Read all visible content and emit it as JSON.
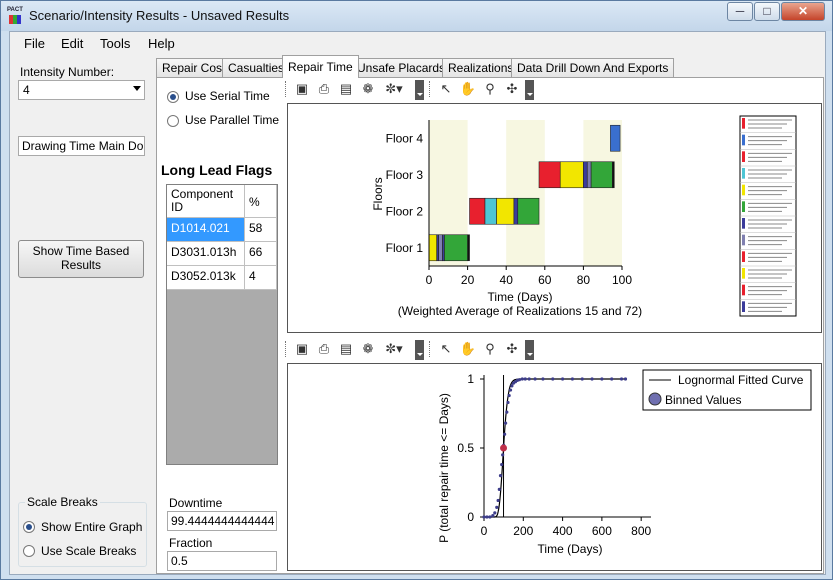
{
  "window": {
    "title": "Scenario/Intensity Results - Unsaved Results",
    "app_badge": "PACT"
  },
  "menu": [
    "File",
    "Edit",
    "Tools",
    "Help"
  ],
  "left_panel": {
    "intensity_label": "Intensity Number:",
    "intensity_value": "4",
    "status_text": "Drawing Time Main Done",
    "show_time_button": "Show Time Based Results",
    "scale_breaks": {
      "title": "Scale Breaks",
      "options": [
        "Show Entire Graph",
        "Use Scale Breaks"
      ],
      "selected": 0
    }
  },
  "tabs": [
    "Repair Cost",
    "Casualties",
    "Repair Time",
    "Unsafe Placards",
    "Realizations",
    "Data Drill Down And Exports"
  ],
  "active_tab": 2,
  "repair_time": {
    "time_mode": {
      "options": [
        "Use Serial Time",
        "Use Parallel Time"
      ],
      "selected": 0
    },
    "long_lead_title": "Long Lead Flags",
    "grid": {
      "headers": [
        "Component ID",
        "%"
      ],
      "rows": [
        [
          "D1014.021",
          "58"
        ],
        [
          "D3031.013h",
          "66"
        ],
        [
          "D3052.013k",
          "4"
        ]
      ],
      "selected_row": 0
    },
    "downtime_label": "Downtime",
    "downtime_value": "99.4444444444444",
    "fraction_label": "Fraction",
    "fraction_value": "0.5"
  },
  "colors": {
    "accent": "#3399ff",
    "band": "#f7f7e1",
    "fit_curve": "#000000",
    "binned": "#3d3d8a",
    "median": "#c0304a"
  },
  "chart_data": [
    {
      "type": "bar",
      "orientation": "horizontal-gantt",
      "title": "",
      "xlabel": "Time (Days)",
      "subtitle": "(Weighted Average of Realizations 15 and 72)",
      "ylabel": "Floors",
      "categories": [
        "Floor 1",
        "Floor 2",
        "Floor 3",
        "Floor 4"
      ],
      "xlim": [
        0,
        100
      ],
      "xticks": [
        0,
        20,
        40,
        60,
        80,
        100
      ],
      "bands": [
        [
          0,
          20
        ],
        [
          40,
          60
        ],
        [
          80,
          100
        ]
      ],
      "segments": [
        {
          "floor": "Floor 1",
          "start": 0,
          "end": 4,
          "color": "#f2e600"
        },
        {
          "floor": "Floor 1",
          "start": 4,
          "end": 5,
          "color": "#3b3b9a"
        },
        {
          "floor": "Floor 1",
          "start": 5,
          "end": 7,
          "color": "#8080b0"
        },
        {
          "floor": "Floor 1",
          "start": 7,
          "end": 8,
          "color": "#3b3b9a"
        },
        {
          "floor": "Floor 1",
          "start": 8,
          "end": 20,
          "color": "#33a639"
        },
        {
          "floor": "Floor 1",
          "start": 20,
          "end": 21,
          "color": "#111111"
        },
        {
          "floor": "Floor 2",
          "start": 21,
          "end": 29,
          "color": "#e8202e"
        },
        {
          "floor": "Floor 2",
          "start": 29,
          "end": 35,
          "color": "#4ec5d4"
        },
        {
          "floor": "Floor 2",
          "start": 35,
          "end": 44,
          "color": "#f2e600"
        },
        {
          "floor": "Floor 2",
          "start": 44,
          "end": 46,
          "color": "#3b3b9a"
        },
        {
          "floor": "Floor 2",
          "start": 46,
          "end": 57,
          "color": "#33a639"
        },
        {
          "floor": "Floor 3",
          "start": 57,
          "end": 68,
          "color": "#e8202e"
        },
        {
          "floor": "Floor 3",
          "start": 68,
          "end": 80,
          "color": "#f2e600"
        },
        {
          "floor": "Floor 3",
          "start": 80,
          "end": 82,
          "color": "#3b3b9a"
        },
        {
          "floor": "Floor 3",
          "start": 82,
          "end": 84,
          "color": "#7a7ab0"
        },
        {
          "floor": "Floor 3",
          "start": 84,
          "end": 95,
          "color": "#33a639"
        },
        {
          "floor": "Floor 3",
          "start": 95,
          "end": 96,
          "color": "#111111"
        },
        {
          "floor": "Floor 4",
          "start": 94,
          "end": 99,
          "color": "#3a6fcf"
        }
      ],
      "legend_entries": 12,
      "legend_colors": [
        "#e8202e",
        "#3a6fcf",
        "#e8202e",
        "#4ec5d4",
        "#f2e600",
        "#33a639",
        "#3b3b9a",
        "#8080b0",
        "#e8202e",
        "#f2e600",
        "#e8202e",
        "#3b3b9a"
      ]
    },
    {
      "type": "line",
      "title": "",
      "xlabel": "Time (Days)",
      "ylabel": "P (total repair time <= Days)",
      "xlim": [
        0,
        850
      ],
      "ylim": [
        0,
        1
      ],
      "xticks": [
        0,
        200,
        400,
        600,
        800
      ],
      "yticks": [
        0,
        0.5,
        1
      ],
      "series": [
        {
          "name": "Lognormal Fitted Curve",
          "style": "line",
          "median": 99.4,
          "beta": 0.18
        },
        {
          "name": "Binned Values",
          "style": "markers",
          "x": [
            0,
            15,
            30,
            45,
            55,
            65,
            72,
            78,
            84,
            90,
            95,
            100,
            105,
            110,
            116,
            122,
            128,
            135,
            142,
            150,
            160,
            170,
            180,
            195,
            210,
            230,
            260,
            300,
            350,
            400,
            450,
            500,
            550,
            600,
            650,
            700,
            720
          ],
          "y": [
            0,
            0,
            0,
            0.01,
            0.03,
            0.07,
            0.12,
            0.2,
            0.3,
            0.38,
            0.45,
            0.52,
            0.6,
            0.68,
            0.76,
            0.83,
            0.88,
            0.92,
            0.95,
            0.97,
            0.98,
            0.99,
            0.995,
            1,
            1,
            1,
            1,
            1,
            1,
            1,
            1,
            1,
            1,
            1,
            1,
            1,
            1
          ]
        }
      ],
      "median_marker": {
        "x": 99.4,
        "y": 0.5
      },
      "vertical_line_x": 99.4,
      "legend_placement": "top-right"
    }
  ]
}
